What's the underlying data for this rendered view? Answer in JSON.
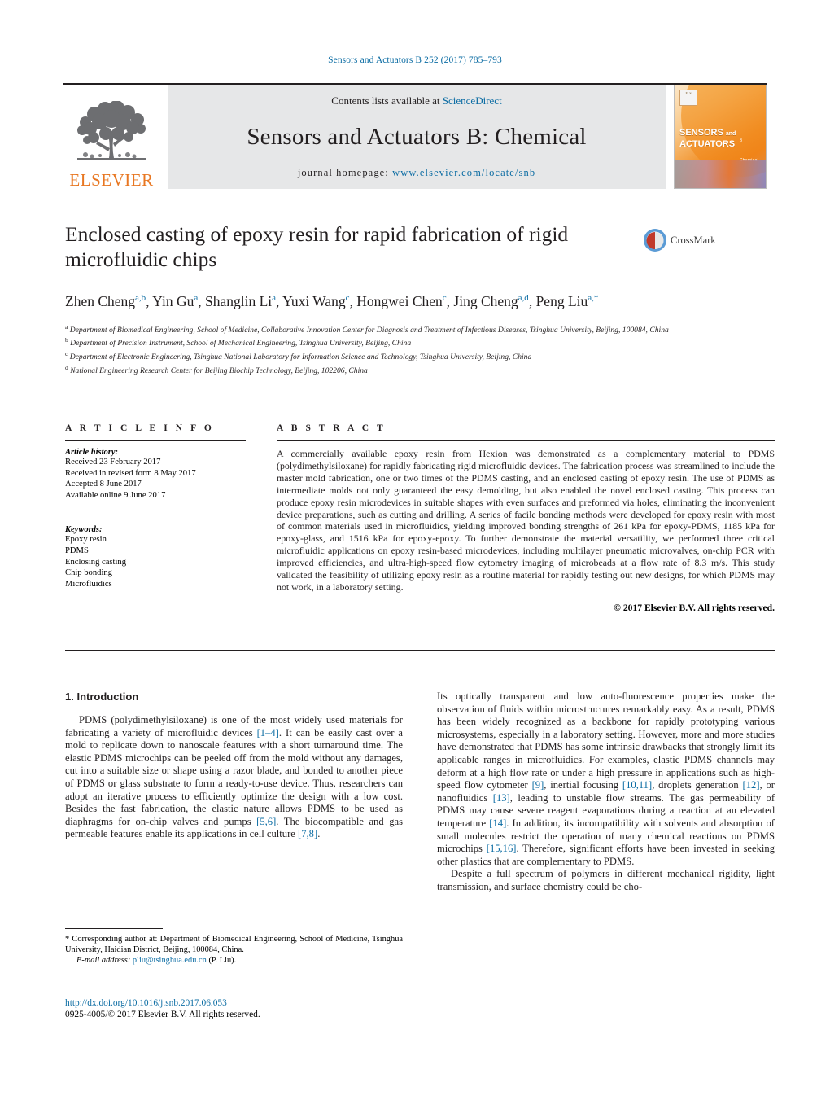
{
  "running_head": "Sensors and Actuators B 252 (2017) 785–793",
  "masthead": {
    "publisher": "ELSEVIER",
    "contents_prefix": "Contents lists available at ",
    "contents_link": "ScienceDirect",
    "journal_name": "Sensors and Actuators B: Chemical",
    "homepage_prefix": "journal homepage: ",
    "homepage_url": "www.elsevier.com/locate/snb",
    "cover": {
      "line1": "SENSORS",
      "and": "and",
      "line2": "ACTUATORS",
      "letter": "B",
      "letter_sub": "Chemical"
    }
  },
  "article": {
    "title": "Enclosed casting of epoxy resin for rapid fabrication of rigid microfluidic chips",
    "crossmark_label": "CrossMark",
    "authors": [
      {
        "name": "Zhen Cheng",
        "sup": "a,b"
      },
      {
        "name": "Yin Gu",
        "sup": "a"
      },
      {
        "name": "Shanglin Li",
        "sup": "a"
      },
      {
        "name": "Yuxi Wang",
        "sup": "c"
      },
      {
        "name": "Hongwei Chen",
        "sup": "c"
      },
      {
        "name": "Jing Cheng",
        "sup": "a,d"
      },
      {
        "name": "Peng Liu",
        "sup": "a,*"
      }
    ],
    "affiliations": [
      {
        "mark": "a",
        "text": "Department of Biomedical Engineering, School of Medicine, Collaborative Innovation Center for Diagnosis and Treatment of Infectious Diseases, Tsinghua University, Beijing, 100084, China"
      },
      {
        "mark": "b",
        "text": "Department of Precision Instrument, School of Mechanical Engineering, Tsinghua University, Beijing, China"
      },
      {
        "mark": "c",
        "text": "Department of Electronic Engineering, Tsinghua National Laboratory for Information Science and Technology, Tsinghua University, Beijing, China"
      },
      {
        "mark": "d",
        "text": "National Engineering Research Center for Beijing Biochip Technology, Beijing, 102206, China"
      }
    ]
  },
  "article_info": {
    "heading": "A R T I C L E    I N F O",
    "history_label": "Article history:",
    "history": [
      "Received 23 February 2017",
      "Received in revised form 8 May 2017",
      "Accepted 8 June 2017",
      "Available online 9 June 2017"
    ],
    "keywords_label": "Keywords:",
    "keywords": [
      "Epoxy resin",
      "PDMS",
      "Enclosing casting",
      "Chip bonding",
      "Microfluidics"
    ]
  },
  "abstract": {
    "heading": "A B S T R A C T",
    "text": "A commercially available epoxy resin from Hexion was demonstrated as a complementary material to PDMS (polydimethylsiloxane) for rapidly fabricating rigid microfluidic devices. The fabrication process was streamlined to include the master mold fabrication, one or two times of the PDMS casting, and an enclosed casting of epoxy resin. The use of PDMS as intermediate molds not only guaranteed the easy demolding, but also enabled the novel enclosed casting. This process can produce epoxy resin microdevices in suitable shapes with even surfaces and preformed via holes, eliminating the inconvenient device preparations, such as cutting and drilling. A series of facile bonding methods were developed for epoxy resin with most of common materials used in microfluidics, yielding improved bonding strengths of 261 kPa for epoxy-PDMS, 1185 kPa for epoxy-glass, and 1516 kPa for epoxy-epoxy. To further demonstrate the material versatility, we performed three critical microfluidic applications on epoxy resin-based microdevices, including multilayer pneumatic microvalves, on-chip PCR with improved efficiencies, and ultra-high-speed flow cytometry imaging of microbeads at a flow rate of 8.3 m/s. This study validated the feasibility of utilizing epoxy resin as a routine material for rapidly testing out new designs, for which PDMS may not work, in a laboratory setting.",
    "copyright": "© 2017 Elsevier B.V. All rights reserved."
  },
  "introduction": {
    "heading": "1.  Introduction",
    "paragraph_1_a": "PDMS (polydimethylsiloxane) is one of the most widely used materials for fabricating a variety of microfluidic devices ",
    "cite_1_4": "[1–4]",
    "paragraph_1_b": ". It can be easily cast over a mold to replicate down to nanoscale features with a short turnaround time. The elastic PDMS microchips can be peeled off from the mold without any damages, cut into a suitable size or shape using a razor blade, and bonded to another piece of PDMS or glass substrate to form a ready-to-use device. Thus, researchers can adopt an iterative process to efficiently optimize the design with a low cost. Besides the fast fabrication, the elastic nature allows PDMS to be used as diaphragms for on-chip valves and pumps ",
    "cite_5_6": "[5,6]",
    "paragraph_1_c": ". The biocompatible and gas permeable features enable its applications in cell culture ",
    "cite_7_8": "[7,8]",
    "paragraph_1_d": ". Its optically transparent and low auto-fluorescence properties make the observation of fluids within microstructures remarkably easy. As a result, PDMS has been widely recognized as a backbone for rapidly prototyping various microsystems, especially in a laboratory setting. However, more and more studies have demonstrated that PDMS has some intrinsic drawbacks that strongly limit its applicable ranges in microfluidics. For examples, elastic PDMS channels may deform at a high flow rate or under a high pressure in applications such as high-speed flow cytometer ",
    "cite_9": "[9]",
    "paragraph_1_e": ", inertial focusing ",
    "cite_10_11": "[10,11]",
    "paragraph_1_f": ", droplets generation ",
    "cite_12": "[12]",
    "paragraph_1_g": ", or nanofluidics ",
    "cite_13": "[13]",
    "paragraph_1_h": ", leading to unstable flow streams. The gas permeability of PDMS may cause severe reagent evaporations during a reaction at an elevated temperature ",
    "cite_14": "[14]",
    "paragraph_1_i": ". In addition, its incompatibility with solvents and absorption of small molecules restrict the operation of many chemical reactions on PDMS microchips ",
    "cite_15_16": "[15,16]",
    "paragraph_1_j": ". Therefore, significant efforts have been invested in seeking other plastics that are complementary to PDMS.",
    "paragraph_2": "Despite a full spectrum of polymers in different mechanical rigidity, light transmission, and surface chemistry could be cho-"
  },
  "footnote": {
    "star": "*",
    "text": " Corresponding author at: Department of Biomedical Engineering, School of Medicine, Tsinghua University, Haidian District, Beijing, 100084, China.",
    "email_label": "E-mail address:",
    "email": "pliu@tsinghua.edu.cn",
    "email_suffix": " (P. Liu)."
  },
  "footer": {
    "doi": "http://dx.doi.org/10.1016/j.snb.2017.06.053",
    "issn": "0925-4005/© 2017 Elsevier B.V. All rights reserved."
  },
  "colors": {
    "link": "#0b6ca3",
    "elsevier_orange": "#e87722",
    "ink": "#231f20"
  }
}
